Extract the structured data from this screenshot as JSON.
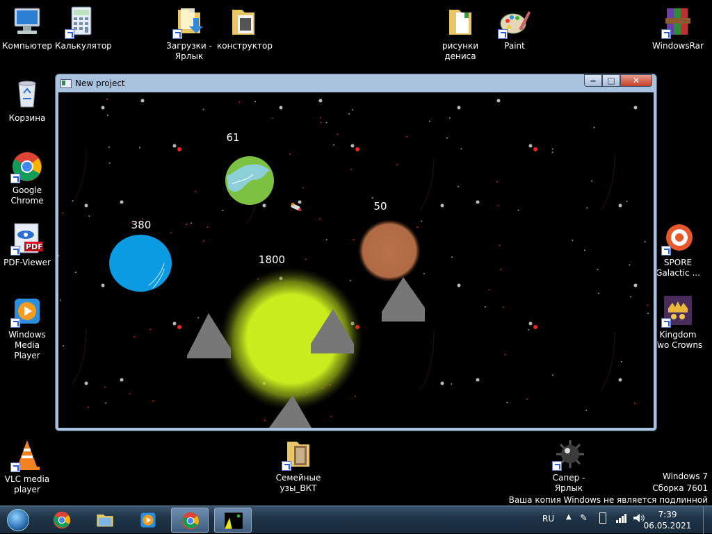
{
  "desktop": {
    "icons": [
      {
        "label": "Компьютер",
        "icon": "computer-icon"
      },
      {
        "label": "Калькулятор",
        "icon": "calculator-icon"
      },
      {
        "label": "Загрузки - Ярлык",
        "icon": "downloads-folder-icon"
      },
      {
        "label": "конструктор",
        "icon": "folder-icon"
      },
      {
        "label": "рисунки дениса",
        "icon": "folder-icon"
      },
      {
        "label": "Paint",
        "icon": "paint-icon"
      },
      {
        "label": "WindowsRar",
        "icon": "winrar-icon"
      },
      {
        "label": "Корзина",
        "icon": "recycle-bin-icon"
      },
      {
        "label": "Google Chrome",
        "icon": "chrome-icon"
      },
      {
        "label": "PDF-Viewer",
        "icon": "pdf-icon"
      },
      {
        "label": "Windows Media Player",
        "icon": "media-player-icon"
      },
      {
        "label": "SPORE Galactic ...",
        "icon": "spore-icon"
      },
      {
        "label": "Kingdom Two Crowns",
        "icon": "kingdom-icon"
      },
      {
        "label": "VLC media player",
        "icon": "vlc-icon"
      },
      {
        "label": "Семейные узы_ВКТ",
        "icon": "folder-icon"
      },
      {
        "label": "Сапер - Ярлык",
        "icon": "minesweeper-icon"
      }
    ]
  },
  "window": {
    "title": "New project",
    "buttons": {
      "minimize": "‒",
      "maximize": "□",
      "close": "✕"
    }
  },
  "game": {
    "planets": [
      {
        "label": "61",
        "color": "#7cc142"
      },
      {
        "label": "380",
        "color": "#0a9be3"
      },
      {
        "label": "50",
        "color": "#b8714a"
      },
      {
        "label": "1800",
        "color": "#c8ec1e"
      }
    ]
  },
  "taskbar": {
    "language": "RU",
    "time": "7:39",
    "date": "06.05.2021"
  },
  "watermark": {
    "line1": "Windows 7",
    "line2": "Сборка 7601",
    "line3": "Ваша копия Windows не является подлинной"
  }
}
